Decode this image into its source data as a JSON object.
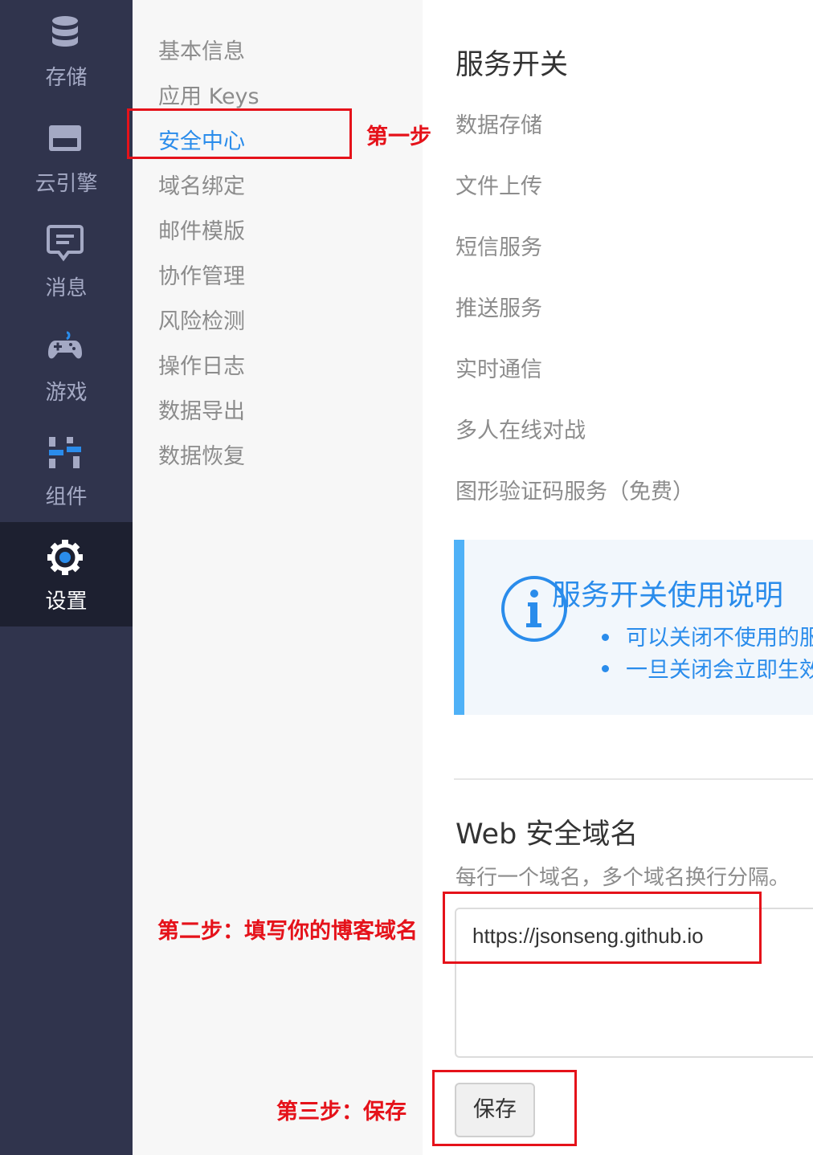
{
  "left_nav": [
    {
      "label": "存储",
      "icon": "database-icon",
      "active": false
    },
    {
      "label": "云引擎",
      "icon": "server-icon",
      "active": false
    },
    {
      "label": "消息",
      "icon": "chat-icon",
      "active": false
    },
    {
      "label": "游戏",
      "icon": "gamepad-icon",
      "active": false
    },
    {
      "label": "组件",
      "icon": "components-icon",
      "active": false
    },
    {
      "label": "设置",
      "icon": "gear-icon",
      "active": true
    }
  ],
  "sub_menu": [
    {
      "label": "基本信息",
      "active": false
    },
    {
      "label": "应用 Keys",
      "active": false
    },
    {
      "label": "安全中心",
      "active": true
    },
    {
      "label": "域名绑定",
      "active": false
    },
    {
      "label": "邮件模版",
      "active": false
    },
    {
      "label": "协作管理",
      "active": false
    },
    {
      "label": "风险检测",
      "active": false
    },
    {
      "label": "操作日志",
      "active": false
    },
    {
      "label": "数据导出",
      "active": false
    },
    {
      "label": "数据恢复",
      "active": false
    }
  ],
  "main": {
    "service_switch_title": "服务开关",
    "services": [
      "数据存储",
      "文件上传",
      "短信服务",
      "推送服务",
      "实时通信",
      "多人在线对战",
      "图形验证码服务（免费）"
    ],
    "info_box": {
      "title": "服务开关使用说明",
      "bullets": [
        "可以关闭不使用的服务",
        "一旦关闭会立即生效"
      ],
      "icon": "info-icon"
    },
    "web_domain_title": "Web 安全域名",
    "web_domain_hint": "每行一个域名，多个域名换行分隔。",
    "domain_value": "https://jsonseng.github.io",
    "save_label": "保存"
  },
  "annotations": {
    "step1": "第一步",
    "step2": "第二步：填写你的博客域名",
    "step3": "第三步：保存"
  },
  "colors": {
    "nav_bg": "#30344d",
    "nav_active_bg": "#1d2030",
    "accent": "#2a8ceb",
    "annotation_red": "#e5121a",
    "info_bar": "#4fb1f7"
  }
}
